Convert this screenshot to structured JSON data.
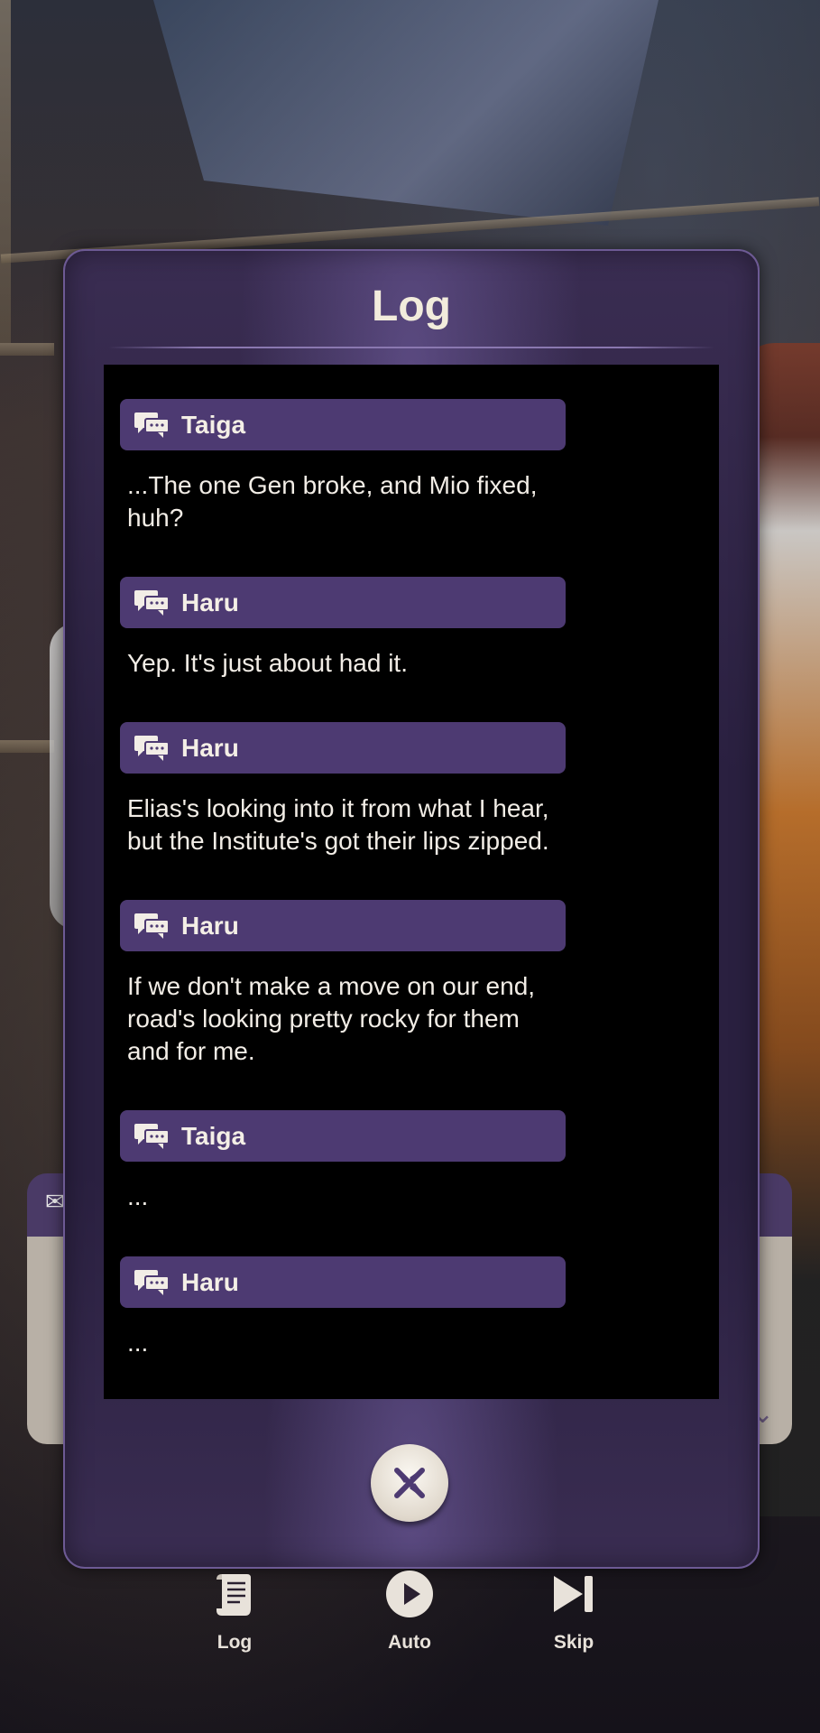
{
  "modal": {
    "title": "Log"
  },
  "entries": [
    {
      "speaker": "Taiga",
      "text": "...The one Gen broke, and Mio fixed, huh?"
    },
    {
      "speaker": "Haru",
      "text": "Yep. It's just about had it."
    },
    {
      "speaker": "Haru",
      "text": "Elias's looking into it from what I hear, but the Institute's got their lips zipped."
    },
    {
      "speaker": "Haru",
      "text": "If we don't make a move on our end, road's looking pretty rocky for them and for me."
    },
    {
      "speaker": "Taiga",
      "text": "..."
    },
    {
      "speaker": "Haru",
      "text": "..."
    }
  ],
  "controls": {
    "log_label": "Log",
    "auto_label": "Auto",
    "skip_label": "Skip"
  },
  "icons": {
    "speaker": "chat-bubbles-icon",
    "close": "close-x-icon",
    "log": "scroll-icon",
    "auto": "play-icon",
    "skip": "skip-icon"
  },
  "colors": {
    "name_bar": "#4d3a72",
    "modal_border": "#6d5a94",
    "accent_text": "#f2ecdc"
  }
}
